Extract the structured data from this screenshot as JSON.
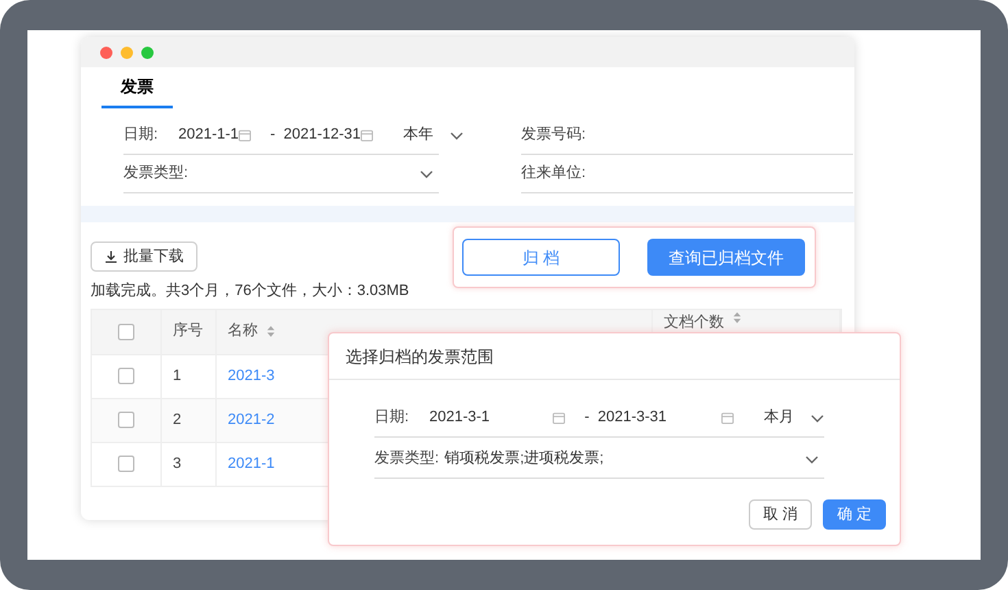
{
  "tabs": [
    {
      "label": "发票",
      "selected": true
    }
  ],
  "filters": [
    {
      "kind": "daterange",
      "label": "日期:",
      "from": "2021-1-1",
      "separator": "-",
      "to": "2021-12-31",
      "preset": "本年"
    },
    {
      "kind": "text",
      "label": "发票号码:"
    },
    {
      "kind": "select",
      "label": "发票类型:"
    },
    {
      "kind": "text",
      "label": "往来单位:"
    }
  ],
  "download_button": "批量下载",
  "status": "加载完成。共3个月，76个文件，大小：3.03MB",
  "archive_buttons": [
    {
      "label": "归 档",
      "kind": "outline"
    },
    {
      "label": "查询已归档文件",
      "kind": "primary"
    }
  ],
  "table": {
    "all_checked": false,
    "columns": [
      "序号",
      "名称",
      "文档个数"
    ],
    "rows": [
      {
        "index": "1",
        "name": "2021-3",
        "checked": false
      },
      {
        "index": "2",
        "name": "2021-2",
        "checked": false
      },
      {
        "index": "3",
        "name": "2021-1",
        "checked": false
      }
    ]
  },
  "dialog": {
    "title": "选择归档的发票范围",
    "fields": [
      {
        "kind": "daterange",
        "label": "日期:",
        "from": "2021-3-1",
        "separator": "-",
        "to": "2021-3-31",
        "preset": "本月"
      },
      {
        "kind": "select",
        "label": "发票类型:",
        "value": "销项税发票;进项税发票;"
      }
    ],
    "buttons": [
      {
        "label": "取 消",
        "kind": "outline"
      },
      {
        "label": "确 定",
        "kind": "primary"
      }
    ]
  }
}
